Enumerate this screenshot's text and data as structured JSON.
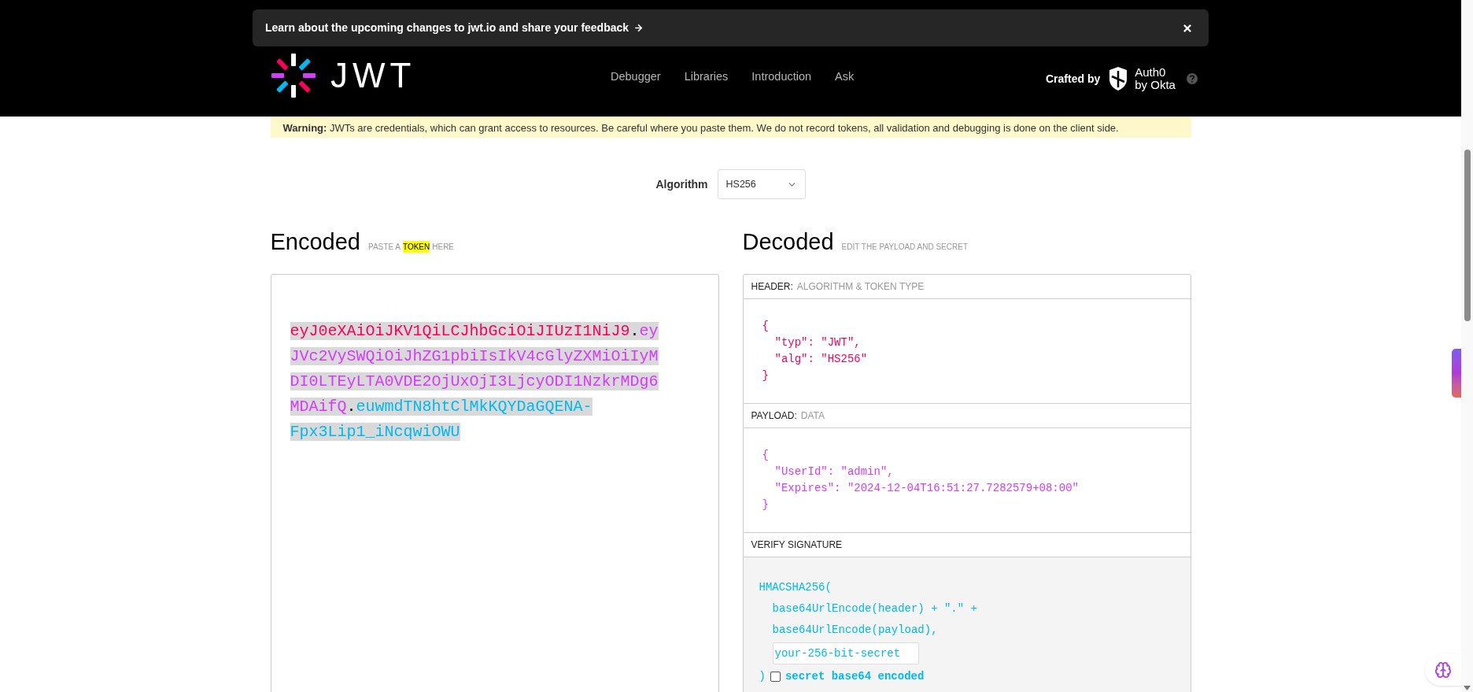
{
  "banner": {
    "text": "Learn about the upcoming changes to jwt.io and share your feedback"
  },
  "header": {
    "logo_text": "JWT",
    "nav": [
      "Debugger",
      "Libraries",
      "Introduction",
      "Ask"
    ],
    "crafted_by": "Crafted by",
    "partner_lines": [
      "Auth0",
      "by Okta"
    ]
  },
  "warning": {
    "text": "**Warning:** JWTs are credentials, which can grant access to resources. Be careful where you paste them. We do not record tokens, all validation and debugging is done on the client side."
  },
  "algorithm": {
    "label": "Algorithm",
    "value": "HS256"
  },
  "encoded": {
    "title": "Encoded",
    "hint": [
      {
        "text": "PASTE A",
        "highlighted": false
      },
      {
        "text": "TOKEN",
        "highlighted": true
      },
      {
        "text": "HERE",
        "highlighted": false
      }
    ],
    "token": [
      {
        "kind": "header",
        "text": "eyJ0eXAiOiJKV1QiLCJhbGciOiJIUzI1NiJ9"
      },
      {
        "kind": "dot",
        "text": "."
      },
      {
        "kind": "payload",
        "text": "eyJVc2VySWQiOiJhZG1pbiIsIkV4cGlyZXMiOiIyMDI0LTEyLTA0VDE2OjUxOjI3LjcyODI1NzkrMDg6MDAifQ"
      },
      {
        "kind": "dot",
        "text": "."
      },
      {
        "kind": "signature",
        "text": "euwmdTN8htClMkKQYDaGQENA-Fpx3Lip1_iNcqwiOWU"
      }
    ]
  },
  "decoded": {
    "title": "Decoded",
    "hint": "EDIT THE PAYLOAD AND SECRET",
    "sections": [
      {
        "kind": "header",
        "label": "HEADER:",
        "hint": "ALGORITHM & TOKEN TYPE",
        "open": "{",
        "fields": [
          "\"typ\": \"JWT\",",
          "\"alg\": \"HS256\""
        ],
        "close": "}"
      },
      {
        "kind": "payload",
        "label": "PAYLOAD:",
        "hint": "DATA",
        "open": "{",
        "fields": [
          "\"UserId\": \"admin\",",
          "\"Expires\": \"2024-12-04T16:51:27.7282579+08:00\""
        ],
        "close": "}"
      }
    ],
    "verify": {
      "label": "VERIFY SIGNATURE",
      "first_line": "HMACSHA256(",
      "lines": [
        "base64UrlEncode(header) + \".\" +",
        "base64UrlEncode(payload),"
      ],
      "secret_placeholder": "your-256-bit-secret",
      "close": ")",
      "checkbox": {
        "label": "secret base64 encoded",
        "checked": false
      }
    }
  }
}
